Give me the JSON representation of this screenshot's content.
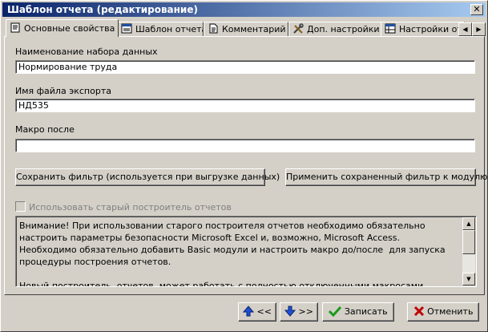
{
  "window": {
    "title": "Шаблон отчета (редактирование)",
    "close_glyph": "✕"
  },
  "tabs": [
    {
      "label": "Основные свойства",
      "icon": "property-page-icon",
      "active": true
    },
    {
      "label": "Шаблон отчета",
      "icon": "report-template-icon"
    },
    {
      "label": "Комментарий",
      "icon": "document-icon"
    },
    {
      "label": "Доп. настройки",
      "icon": "tools-icon"
    },
    {
      "label": "Настройки отч",
      "icon": "grid-settings-icon"
    }
  ],
  "tab_scroll": {
    "left": "◀",
    "right": "▶"
  },
  "fields": {
    "dataset_name": {
      "label": "Наименование набора данных",
      "value": "Нормирование труда"
    },
    "export_file": {
      "label": "Имя файла экспорта",
      "value": "НД535"
    },
    "macro_after": {
      "label": "Макро после",
      "value": ""
    }
  },
  "buttons": {
    "save_filter": "Сохранить фильтр (используется при выгрузке данных)",
    "apply_filter": "Применить сохраненный фильтр к модулю"
  },
  "old_builder_checkbox": {
    "label": "Использовать старый построитель отчетов",
    "checked": false,
    "enabled": false
  },
  "memo": {
    "text": "Внимание! При использовании старого построителя отчетов необходимо обязательно настроить параметры безопасности Microsoft Excel и, возможно, Microsoft Access. Необходимо обязательно добавить Basic модули и настроить макро до/после  для запуска процедуры построения отчетов.\n\nНовый построитель  отчетов  может работать с полностью отключенными макросами (больше не требуются Basic модули, не требуются  никакие макро до или после), все вызовы макросов по умолчанию"
  },
  "bottom": {
    "prev_label": "<<",
    "next_label": ">>",
    "save_label": "Записать",
    "cancel_label": "Отменить"
  },
  "colors": {
    "title_start": "#0a246a",
    "title_end": "#a6caf0",
    "face": "#d4d0c8",
    "arrow_blue": "#1f4fd8",
    "cancel_red": "#c00000",
    "check_green": "#1a9a1a"
  }
}
